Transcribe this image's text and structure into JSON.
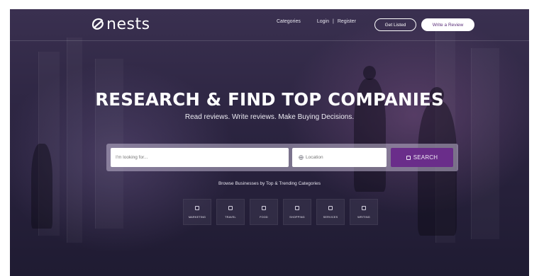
{
  "nav": {
    "logo_text": "nests",
    "categories": "Categories",
    "login": "Login",
    "separator": "|",
    "register": "Register",
    "get_listed": "Get Listed",
    "write_review": "Write a Review"
  },
  "hero": {
    "title": "RESEARCH & FIND TOP COMPANIES",
    "subtitle": "Read reviews. Write reviews. Make Buying Decisions."
  },
  "search": {
    "keyword_placeholder": "I'm looking for...",
    "location_placeholder": "Location",
    "button_label": "SEARCH"
  },
  "browse": {
    "label": "Browse Businesses by Top & Trending Categories",
    "categories": [
      {
        "label": "MARKETING"
      },
      {
        "label": "TRAVEL"
      },
      {
        "label": "FOOD"
      },
      {
        "label": "SHOPPING"
      },
      {
        "label": "SERVICES"
      },
      {
        "label": "WRITING"
      }
    ]
  },
  "colors": {
    "accent": "#6a2d8a",
    "overlay": "#2b2440"
  }
}
